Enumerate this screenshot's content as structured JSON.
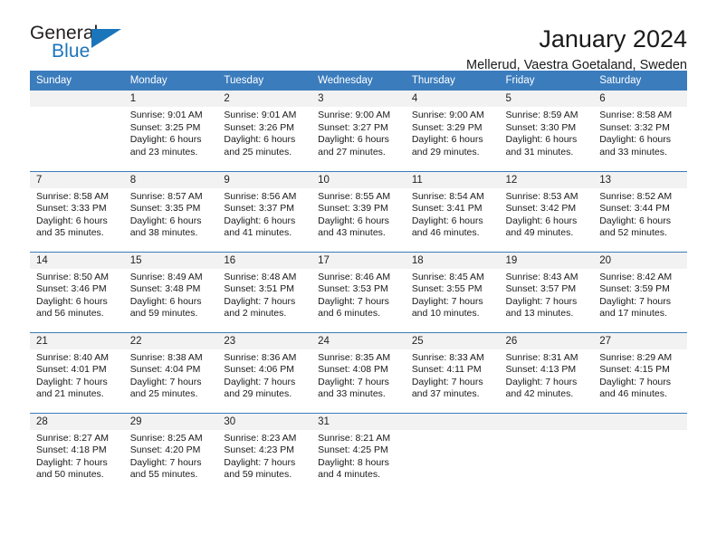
{
  "brand": {
    "name_part1": "General",
    "name_part2": "Blue",
    "triangle_icon": "blue-triangle-icon",
    "color_dark": "#231f20",
    "color_blue": "#1b75bb"
  },
  "header": {
    "title": "January 2024",
    "subtitle": "Mellerud, Vaestra Goetaland, Sweden"
  },
  "theme": {
    "header_row_bg": "#3b7cbd",
    "day_number_bg": "#f2f2f2",
    "text_color": "#1a1a1a"
  },
  "weekday_headers": [
    "Sunday",
    "Monday",
    "Tuesday",
    "Wednesday",
    "Thursday",
    "Friday",
    "Saturday"
  ],
  "weeks": [
    [
      {
        "day": "",
        "info": ""
      },
      {
        "day": "1",
        "info": "Sunrise: 9:01 AM\nSunset: 3:25 PM\nDaylight: 6 hours\nand 23 minutes."
      },
      {
        "day": "2",
        "info": "Sunrise: 9:01 AM\nSunset: 3:26 PM\nDaylight: 6 hours\nand 25 minutes."
      },
      {
        "day": "3",
        "info": "Sunrise: 9:00 AM\nSunset: 3:27 PM\nDaylight: 6 hours\nand 27 minutes."
      },
      {
        "day": "4",
        "info": "Sunrise: 9:00 AM\nSunset: 3:29 PM\nDaylight: 6 hours\nand 29 minutes."
      },
      {
        "day": "5",
        "info": "Sunrise: 8:59 AM\nSunset: 3:30 PM\nDaylight: 6 hours\nand 31 minutes."
      },
      {
        "day": "6",
        "info": "Sunrise: 8:58 AM\nSunset: 3:32 PM\nDaylight: 6 hours\nand 33 minutes."
      }
    ],
    [
      {
        "day": "7",
        "info": "Sunrise: 8:58 AM\nSunset: 3:33 PM\nDaylight: 6 hours\nand 35 minutes."
      },
      {
        "day": "8",
        "info": "Sunrise: 8:57 AM\nSunset: 3:35 PM\nDaylight: 6 hours\nand 38 minutes."
      },
      {
        "day": "9",
        "info": "Sunrise: 8:56 AM\nSunset: 3:37 PM\nDaylight: 6 hours\nand 41 minutes."
      },
      {
        "day": "10",
        "info": "Sunrise: 8:55 AM\nSunset: 3:39 PM\nDaylight: 6 hours\nand 43 minutes."
      },
      {
        "day": "11",
        "info": "Sunrise: 8:54 AM\nSunset: 3:41 PM\nDaylight: 6 hours\nand 46 minutes."
      },
      {
        "day": "12",
        "info": "Sunrise: 8:53 AM\nSunset: 3:42 PM\nDaylight: 6 hours\nand 49 minutes."
      },
      {
        "day": "13",
        "info": "Sunrise: 8:52 AM\nSunset: 3:44 PM\nDaylight: 6 hours\nand 52 minutes."
      }
    ],
    [
      {
        "day": "14",
        "info": "Sunrise: 8:50 AM\nSunset: 3:46 PM\nDaylight: 6 hours\nand 56 minutes."
      },
      {
        "day": "15",
        "info": "Sunrise: 8:49 AM\nSunset: 3:48 PM\nDaylight: 6 hours\nand 59 minutes."
      },
      {
        "day": "16",
        "info": "Sunrise: 8:48 AM\nSunset: 3:51 PM\nDaylight: 7 hours\nand 2 minutes."
      },
      {
        "day": "17",
        "info": "Sunrise: 8:46 AM\nSunset: 3:53 PM\nDaylight: 7 hours\nand 6 minutes."
      },
      {
        "day": "18",
        "info": "Sunrise: 8:45 AM\nSunset: 3:55 PM\nDaylight: 7 hours\nand 10 minutes."
      },
      {
        "day": "19",
        "info": "Sunrise: 8:43 AM\nSunset: 3:57 PM\nDaylight: 7 hours\nand 13 minutes."
      },
      {
        "day": "20",
        "info": "Sunrise: 8:42 AM\nSunset: 3:59 PM\nDaylight: 7 hours\nand 17 minutes."
      }
    ],
    [
      {
        "day": "21",
        "info": "Sunrise: 8:40 AM\nSunset: 4:01 PM\nDaylight: 7 hours\nand 21 minutes."
      },
      {
        "day": "22",
        "info": "Sunrise: 8:38 AM\nSunset: 4:04 PM\nDaylight: 7 hours\nand 25 minutes."
      },
      {
        "day": "23",
        "info": "Sunrise: 8:36 AM\nSunset: 4:06 PM\nDaylight: 7 hours\nand 29 minutes."
      },
      {
        "day": "24",
        "info": "Sunrise: 8:35 AM\nSunset: 4:08 PM\nDaylight: 7 hours\nand 33 minutes."
      },
      {
        "day": "25",
        "info": "Sunrise: 8:33 AM\nSunset: 4:11 PM\nDaylight: 7 hours\nand 37 minutes."
      },
      {
        "day": "26",
        "info": "Sunrise: 8:31 AM\nSunset: 4:13 PM\nDaylight: 7 hours\nand 42 minutes."
      },
      {
        "day": "27",
        "info": "Sunrise: 8:29 AM\nSunset: 4:15 PM\nDaylight: 7 hours\nand 46 minutes."
      }
    ],
    [
      {
        "day": "28",
        "info": "Sunrise: 8:27 AM\nSunset: 4:18 PM\nDaylight: 7 hours\nand 50 minutes."
      },
      {
        "day": "29",
        "info": "Sunrise: 8:25 AM\nSunset: 4:20 PM\nDaylight: 7 hours\nand 55 minutes."
      },
      {
        "day": "30",
        "info": "Sunrise: 8:23 AM\nSunset: 4:23 PM\nDaylight: 7 hours\nand 59 minutes."
      },
      {
        "day": "31",
        "info": "Sunrise: 8:21 AM\nSunset: 4:25 PM\nDaylight: 8 hours\nand 4 minutes."
      },
      {
        "day": "",
        "info": ""
      },
      {
        "day": "",
        "info": ""
      },
      {
        "day": "",
        "info": ""
      }
    ]
  ]
}
